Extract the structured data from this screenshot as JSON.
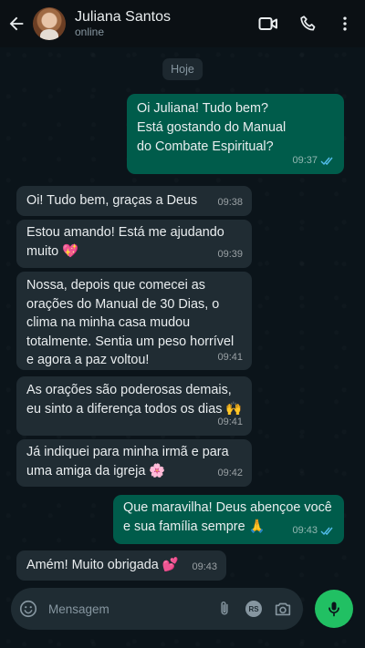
{
  "header": {
    "contact_name": "Juliana Santos",
    "status": "online",
    "icons": [
      "back-arrow-icon",
      "video-call-icon",
      "voice-call-icon",
      "more-options-icon"
    ]
  },
  "date_chip": "Hoje",
  "messages": [
    {
      "direction": "out",
      "text": "Oi Juliana! Tudo bem?\nEstá gostando do Manual\ndo Combate Espiritual?",
      "time": "09:37",
      "read": true
    },
    {
      "direction": "in",
      "text": "Oi! Tudo bem, graças a Deus",
      "time": "09:38"
    },
    {
      "direction": "in",
      "text": "Estou amando! Está me ajudando\nmuito 💖",
      "time": "09:39"
    },
    {
      "direction": "in",
      "text": "Nossa, depois que comecei as\norações do Manual de 30 Dias, o\nclima na minha casa mudou\ntotalmente. Sentia um peso horrível\ne agora a paz voltou!",
      "time": "09:41"
    },
    {
      "direction": "in",
      "text": "As orações são poderosas demais,\neu sinto a diferença todos os dias 🙌",
      "time": "09:41"
    },
    {
      "direction": "in",
      "text": "Já indiquei para minha irmã e para\numa amiga da igreja 🌸",
      "time": "09:42"
    },
    {
      "direction": "out",
      "text": "Que maravilha! Deus abençoe você\ne sua família sempre 🙏",
      "time": "09:43",
      "read": true
    },
    {
      "direction": "in",
      "text": "Amém! Muito obrigada 💕",
      "time": "09:43"
    }
  ],
  "composer": {
    "placeholder": "Mensagem",
    "rs_badge": "RS"
  },
  "colors": {
    "outgoing_bubble": "#005c4b",
    "incoming_bubble": "#202c33",
    "accent": "#21c063",
    "read_ticks": "#53bdeb"
  }
}
